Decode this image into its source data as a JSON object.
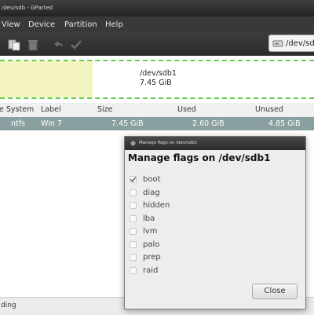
{
  "window": {
    "title": "/dev/sdb - GParted"
  },
  "menubar": {
    "items": [
      "View",
      "Device",
      "Partition",
      "Help"
    ]
  },
  "toolbar": {
    "icons": [
      "paste-icon",
      "delete-icon",
      "undo-icon",
      "apply-icon"
    ],
    "device_selector": "/dev/sdb"
  },
  "graphic": {
    "partition_name": "/dev/sdb1",
    "partition_size": "7.45 GiB",
    "colors": {
      "unallocated": "#f4f4c0",
      "ntfs_outline": "#5fcf49"
    }
  },
  "table": {
    "headers": [
      "e System",
      "Label",
      "Size",
      "Used",
      "Unused"
    ],
    "row": {
      "filesystem": "ntfs",
      "label": "Win 7",
      "size": "7.45 GiB",
      "used": "2.60 GiB",
      "unused": "4.85 GiB"
    },
    "selected_row_color": "#8aa0a0"
  },
  "statusbar": {
    "text": "ding"
  },
  "dialog": {
    "title": "Manage flags on /dev/sdb1",
    "heading": "Manage flags on /dev/sdb1",
    "flags": [
      {
        "name": "boot",
        "checked": true
      },
      {
        "name": "diag",
        "checked": false
      },
      {
        "name": "hidden",
        "checked": false
      },
      {
        "name": "lba",
        "checked": false
      },
      {
        "name": "lvm",
        "checked": false
      },
      {
        "name": "palo",
        "checked": false
      },
      {
        "name": "prep",
        "checked": false
      },
      {
        "name": "raid",
        "checked": false
      }
    ],
    "close_label": "Close"
  }
}
